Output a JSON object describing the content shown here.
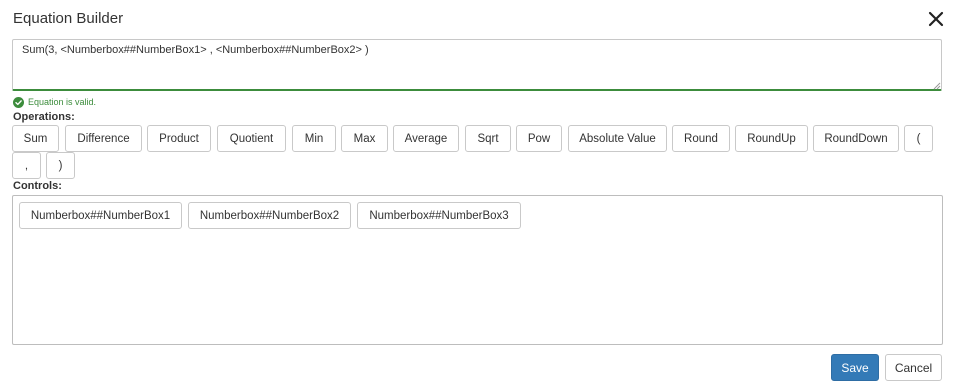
{
  "dialog": {
    "title": "Equation Builder",
    "equation_value": "Sum(3, <Numberbox##NumberBox1> , <Numberbox##NumberBox2> )",
    "validation_message": "Equation is valid.",
    "operations_label": "Operations:",
    "controls_label": "Controls:"
  },
  "operations": [
    "Sum",
    "Difference",
    "Product",
    "Quotient",
    "Min",
    "Max",
    "Average",
    "Sqrt",
    "Pow",
    "Absolute Value",
    "Round",
    "RoundUp",
    "RoundDown",
    "(",
    ",",
    ")"
  ],
  "controls": [
    "Numberbox##NumberBox1",
    "Numberbox##NumberBox2",
    "Numberbox##NumberBox3"
  ],
  "footer": {
    "save_label": "Save",
    "cancel_label": "Cancel"
  },
  "colors": {
    "valid": "#3c8c3c",
    "primary": "#337ab7"
  }
}
